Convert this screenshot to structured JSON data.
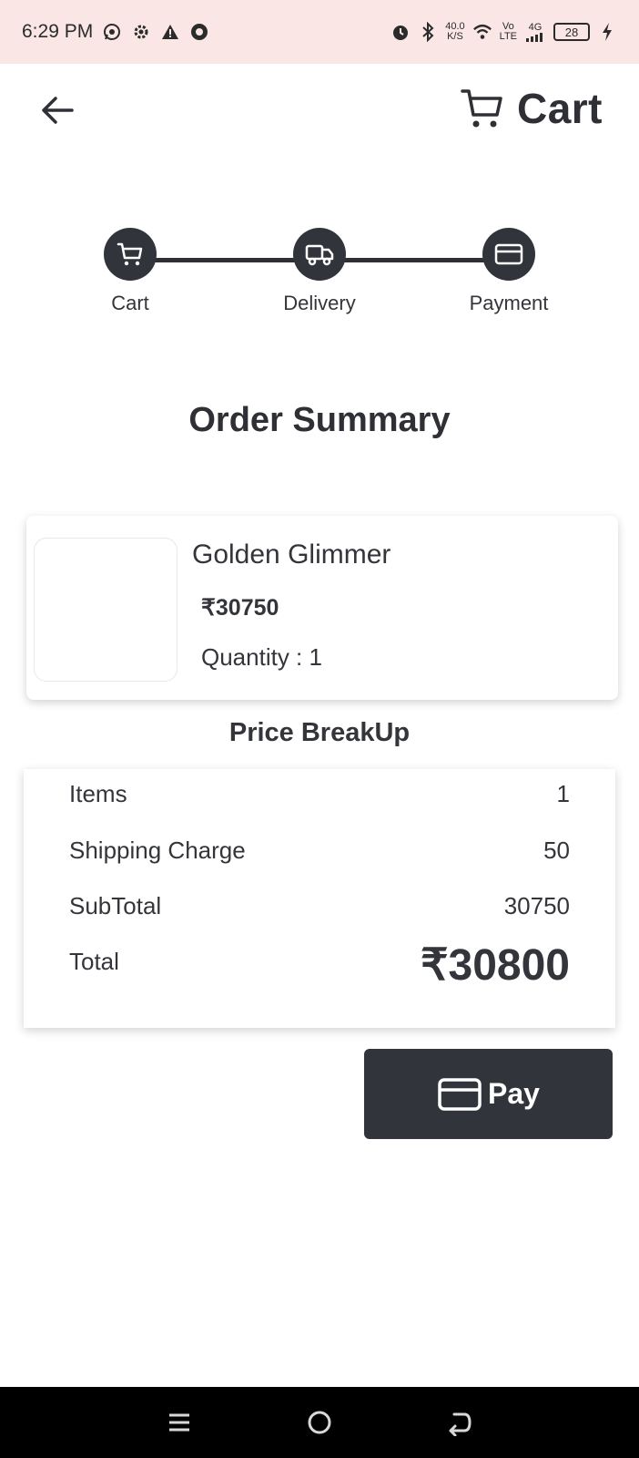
{
  "status_bar": {
    "time": "6:29 PM",
    "net_speed_value": "40.0",
    "net_speed_unit": "K/S",
    "volte_top": "Vo",
    "volte_bottom": "LTE",
    "signal": "4G",
    "battery": "28",
    "icons": [
      "whatsapp-icon",
      "settings-icon",
      "warning-icon",
      "app-icon",
      "alarm-icon",
      "bluetooth-icon",
      "wifi-icon",
      "signal-icon",
      "charging-icon"
    ]
  },
  "header": {
    "title": "Cart",
    "back_icon": "arrow-left-icon",
    "cart_icon": "cart-icon"
  },
  "stepper": {
    "steps": [
      {
        "label": "Cart",
        "icon": "cart-icon"
      },
      {
        "label": "Delivery",
        "icon": "truck-icon"
      },
      {
        "label": "Payment",
        "icon": "credit-card-icon"
      }
    ]
  },
  "order": {
    "title": "Order Summary",
    "product": {
      "name": "Golden Glimmer",
      "price": "₹30750",
      "quantity": "Quantity : 1"
    }
  },
  "price_breakup": {
    "title": "Price BreakUp",
    "rows": [
      {
        "label": "Items",
        "value": "1"
      },
      {
        "label": "Shipping Charge",
        "value": "50"
      },
      {
        "label": "SubTotal",
        "value": "30750"
      },
      {
        "label": "Total",
        "value": "₹30800"
      }
    ]
  },
  "pay_button": {
    "label": "Pay",
    "icon": "credit-card-icon"
  },
  "colors": {
    "primary_dark": "#32343b",
    "status_bar_bg": "#fbe6e6",
    "text": "#2f3036"
  }
}
